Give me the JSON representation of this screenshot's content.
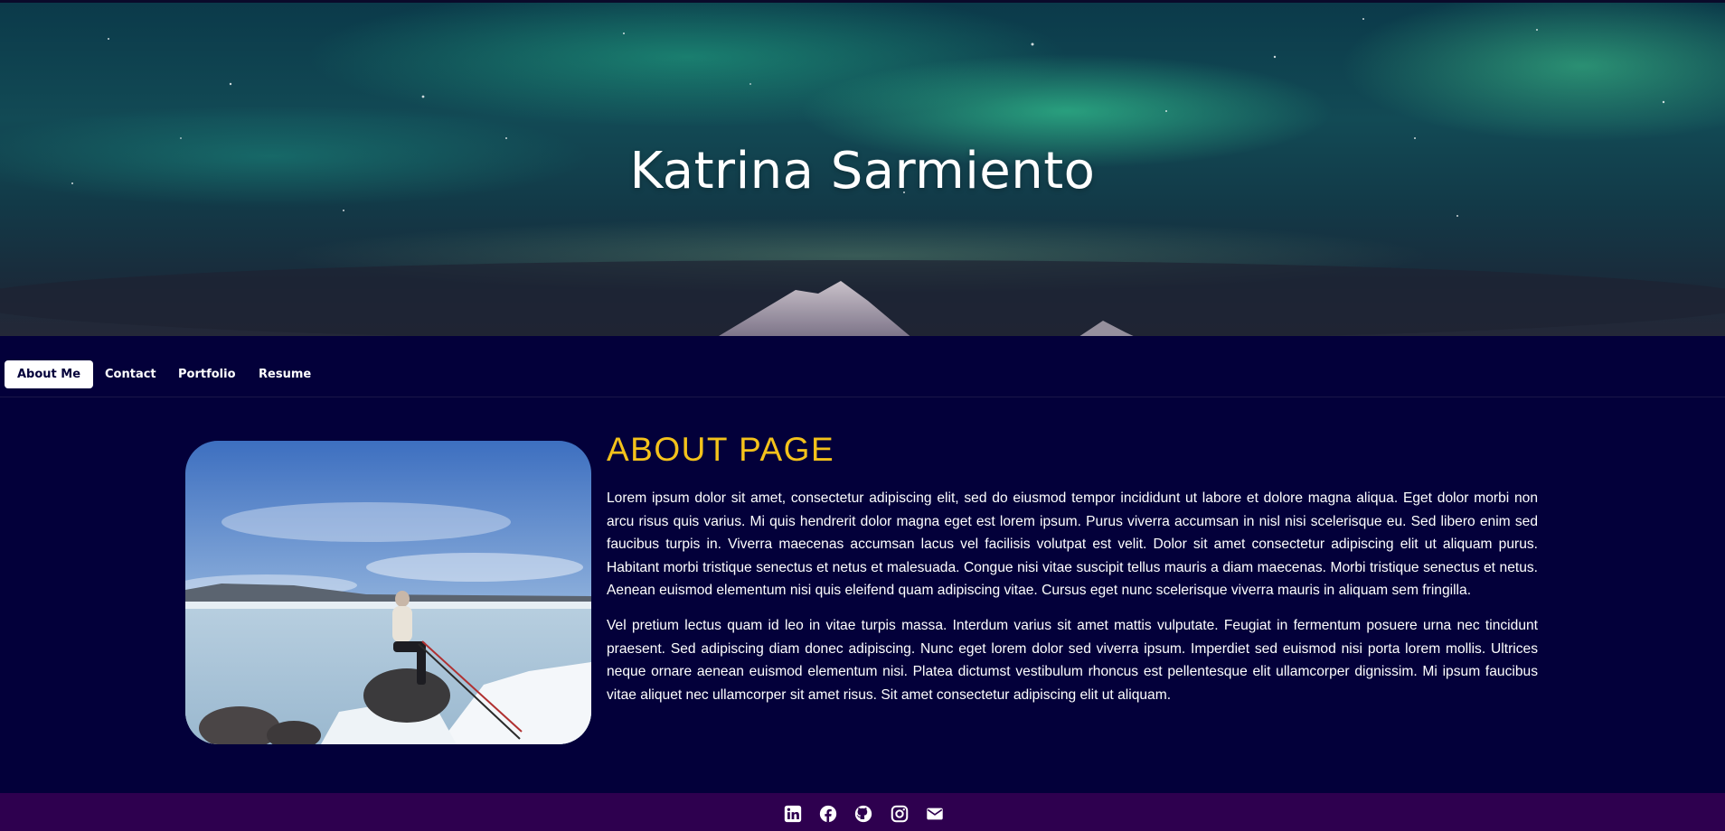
{
  "header": {
    "title": "Katrina Sarmiento"
  },
  "nav": {
    "tabs": [
      {
        "label": "About Me",
        "active": true
      },
      {
        "label": "Contact",
        "active": false
      },
      {
        "label": "Portfolio",
        "active": false
      },
      {
        "label": "Resume",
        "active": false
      }
    ]
  },
  "about": {
    "heading": "ABOUT PAGE",
    "paragraphs": [
      "Lorem ipsum dolor sit amet, consectetur adipiscing elit, sed do eiusmod tempor incididunt ut labore et dolore magna aliqua. Eget dolor morbi non arcu risus quis varius. Mi quis hendrerit dolor magna eget est lorem ipsum. Purus viverra accumsan in nisl nisi scelerisque eu. Sed libero enim sed faucibus turpis in. Viverra maecenas accumsan lacus vel facilisis volutpat est velit. Dolor sit amet consectetur adipiscing elit ut aliquam purus. Habitant morbi tristique senectus et netus et malesuada. Congue nisi vitae suscipit tellus mauris a diam maecenas. Morbi tristique senectus et netus. Aenean euismod elementum nisi quis eleifend quam adipiscing vitae. Cursus eget nunc scelerisque viverra mauris in aliquam sem fringilla.",
      "Vel pretium lectus quam id leo in vitae turpis massa. Interdum varius sit amet mattis vulputate. Feugiat in fermentum posuere urna nec tincidunt praesent. Sed adipiscing diam donec adipiscing. Nunc eget lorem dolor sed viverra ipsum. Imperdiet sed euismod nisi porta lorem mollis. Ultrices neque ornare aenean euismod elementum nisi. Platea dictumst vestibulum rhoncus est pellentesque elit ullamcorper dignissim. Mi ipsum faucibus vitae aliquet nec ullamcorper sit amet risus. Sit amet consectetur adipiscing elit ut aliquam."
    ]
  },
  "footer": {
    "social_icons": [
      "linkedin-icon",
      "facebook-icon",
      "github-icon",
      "instagram-icon",
      "email-icon"
    ]
  },
  "colors": {
    "background": "#03003a",
    "footer": "#2e004f",
    "heading_accent": "#f4c21b",
    "text": "#ffffff",
    "active_tab_bg": "#ffffff"
  }
}
